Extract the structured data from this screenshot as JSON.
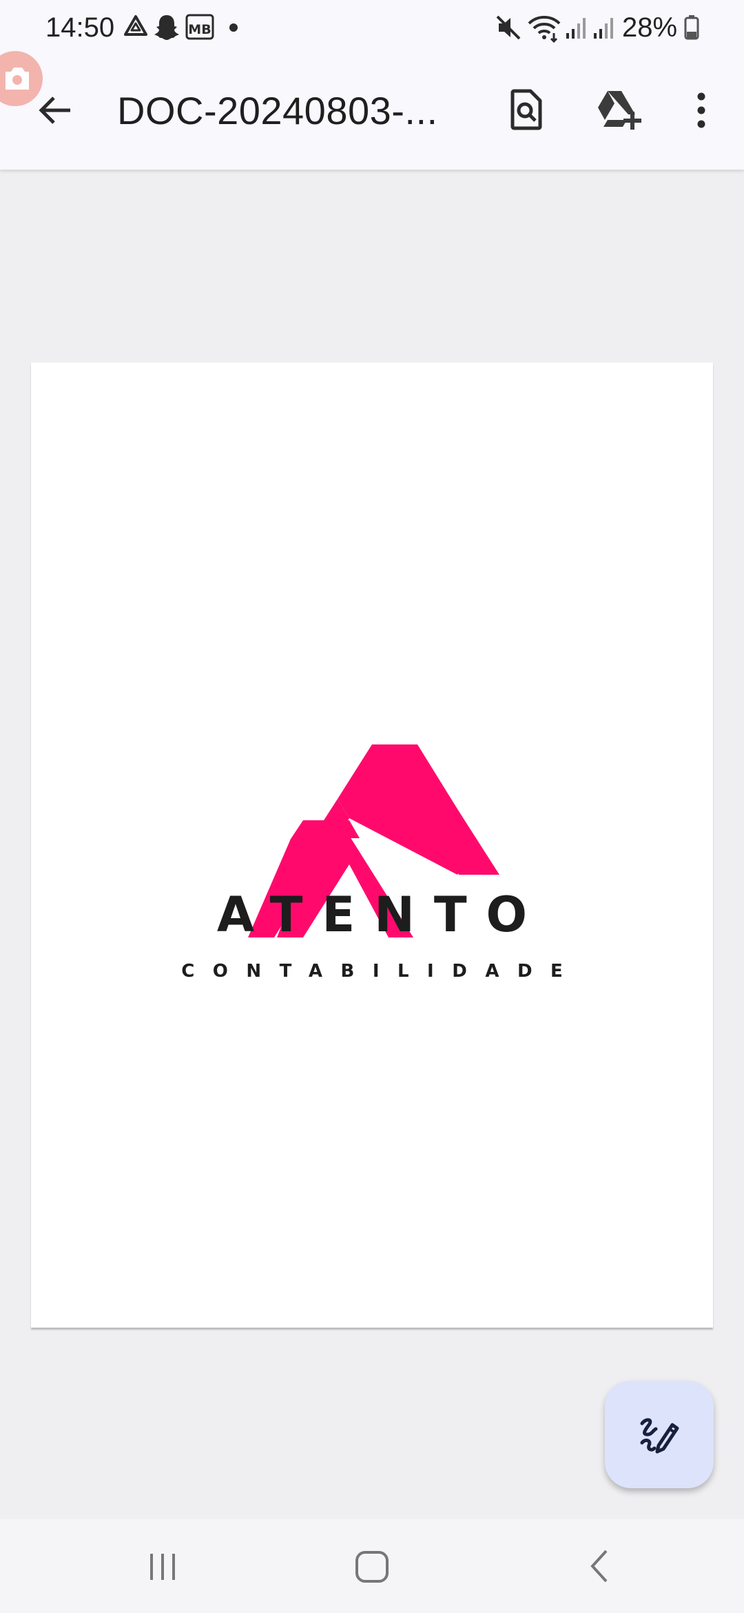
{
  "status_bar": {
    "time": "14:50",
    "battery_percent": "28%",
    "left_icons": [
      "drive-icon",
      "snapchat-icon",
      "mb-icon",
      "notification-dot-icon"
    ],
    "right_icons": [
      "mute-icon",
      "wifi-icon",
      "signal-icon",
      "signal-icon",
      "battery-icon"
    ]
  },
  "app_bar": {
    "title": "DOC-20240803-...",
    "actions": [
      "back-icon",
      "find-in-document-icon",
      "save-to-drive-icon",
      "more-options-icon"
    ]
  },
  "document": {
    "logo_word": "ATENTO",
    "logo_subtitle": "CONTABILIDADE",
    "logo_color": "#ff0a6c"
  },
  "fab": {
    "icon": "edit-annotate-icon",
    "background": "#dde3fb"
  },
  "nav_bar": {
    "buttons": [
      "recent-apps-icon",
      "home-icon",
      "back-nav-icon"
    ]
  }
}
